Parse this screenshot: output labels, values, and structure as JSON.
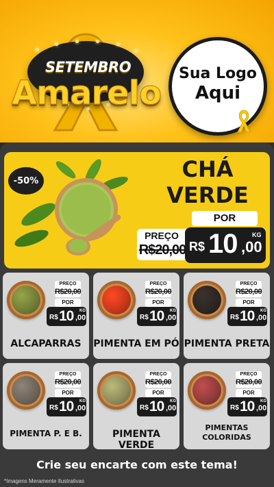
{
  "header": {
    "title_top": "SETEMBRO",
    "title_main": "Amarelo",
    "logo_line1": "Sua Logo",
    "logo_line2": "Aqui",
    "colors": {
      "yellow": "#f7cc17",
      "dark": "#1b1b1b",
      "orange": "#f4a400"
    }
  },
  "hero": {
    "discount": "-50%",
    "name_line1": "CHÁ",
    "name_line2": "VERDE",
    "preco_label": "PREÇO",
    "old_price": "R$20,00",
    "por_label": "POR",
    "currency": "R$",
    "price_int": "10",
    "price_dec": ",00",
    "unit": "KG",
    "image_icon": "green-tea-powder-bowl"
  },
  "products": [
    {
      "name": "ALCAPARRAS",
      "preco_label": "PREÇO",
      "old_price": "R$20,00",
      "por_label": "POR",
      "currency": "R$",
      "price_int": "10",
      "price_dec": ",00",
      "unit": "KG",
      "image_icon": "capers-bowl",
      "color": "#6f7a35"
    },
    {
      "name": "PIMENTA EM PÓ",
      "preco_label": "PREÇO",
      "old_price": "R$20,00",
      "por_label": "POR",
      "currency": "R$",
      "price_int": "10",
      "price_dec": ",00",
      "unit": "KG",
      "image_icon": "chili-powder-bowl",
      "color": "#c2361a"
    },
    {
      "name": "PIMENTA PRETA",
      "preco_label": "PREÇO",
      "old_price": "R$20,00",
      "por_label": "POR",
      "currency": "R$",
      "price_int": "10",
      "price_dec": ",00",
      "unit": "KG",
      "image_icon": "black-pepper-bowl",
      "color": "#2b2522"
    },
    {
      "name": "PIMENTA P. E B.",
      "preco_label": "PREÇO",
      "old_price": "R$20,00",
      "por_label": "POR",
      "currency": "R$",
      "price_int": "10",
      "price_dec": ",00",
      "unit": "KG",
      "image_icon": "black-white-pepper-bowl",
      "color": "#6b6258"
    },
    {
      "name": "PIMENTA VERDE",
      "preco_label": "PREÇO",
      "old_price": "R$20,00",
      "por_label": "POR",
      "currency": "R$",
      "price_int": "10",
      "price_dec": ",00",
      "unit": "KG",
      "image_icon": "green-pepper-bowl",
      "color": "#8c8a5a"
    },
    {
      "name_line1": "PIMENTAS",
      "name_line2": "COLORIDAS",
      "preco_label": "PREÇO",
      "old_price": "R$20,00",
      "por_label": "POR",
      "currency": "R$",
      "price_int": "10",
      "price_dec": ",00",
      "unit": "KG",
      "image_icon": "mixed-peppercorns-bowl",
      "color": "#8e3a3a"
    }
  ],
  "footer": {
    "cta": "Crie seu encarte com este tema!",
    "disclaimer": "*Imagens Meramente Ilustrativas"
  }
}
